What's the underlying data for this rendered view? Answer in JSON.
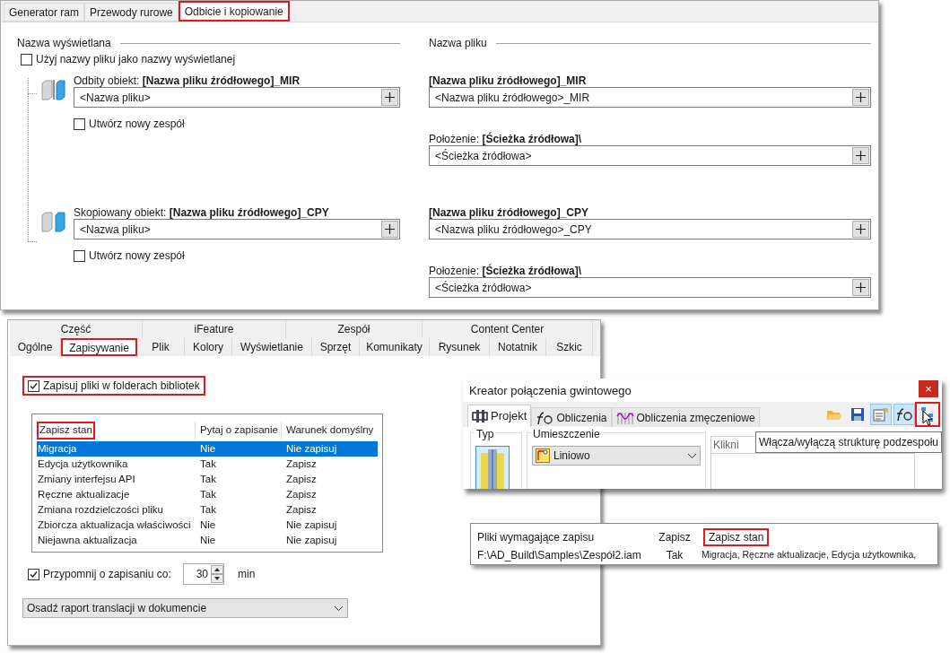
{
  "mirror_dialog": {
    "tabs": [
      {
        "label": "Generator ram",
        "selected": false,
        "highlighted": false
      },
      {
        "label": "Przewody rurowe",
        "selected": false,
        "highlighted": false
      },
      {
        "label": "Odbicie i kopiowanie",
        "selected": true,
        "highlighted": true
      }
    ],
    "display_name": {
      "heading": "Nazwa wyświetlana",
      "use_file_name": {
        "label": "Użyj nazwy pliku jako nazwy wyświetlanej",
        "checked": false
      }
    },
    "file_name": {
      "heading": "Nazwa pliku"
    },
    "items": [
      {
        "kind": "mirror",
        "label": "Odbity obiekt:",
        "value": "[Nazwa pliku źródłowego]_MIR",
        "name_placeholder": "<Nazwa pliku>",
        "new_assembly": {
          "label": "Utwórz nowy zespół",
          "checked": false
        },
        "file_heading": "[Nazwa pliku źródłowego]_MIR",
        "file_value": "<Nazwa pliku źródłowego>_MIR",
        "location_label": "Położenie:",
        "location_bold": "[Ścieżka źródłowa]\\",
        "location_value": "<Ścieżka źródłowa>"
      },
      {
        "kind": "copy",
        "label": "Skopiowany obiekt:",
        "value": "[Nazwa pliku źródłowego]_CPY",
        "name_placeholder": "<Nazwa pliku>",
        "new_assembly": {
          "label": "Utwórz nowy zespół",
          "checked": false
        },
        "file_heading": "[Nazwa pliku źródłowego]_CPY",
        "file_value": "<Nazwa pliku źródłowego>_CPY",
        "location_label": "Położenie:",
        "location_bold": "[Ścieżka źródłowa]\\",
        "location_value": "<Ścieżka źródłowa>"
      }
    ]
  },
  "options_dialog": {
    "tab_rows": [
      [
        {
          "label": "Część",
          "selected": false,
          "highlighted": false
        },
        {
          "label": "iFeature",
          "selected": false,
          "highlighted": false
        },
        {
          "label": "Zespół",
          "selected": false,
          "highlighted": false
        },
        {
          "label": "Content Center",
          "selected": false,
          "highlighted": false
        }
      ],
      [
        {
          "label": "Ogólne",
          "selected": false,
          "highlighted": false
        },
        {
          "label": "Zapisywanie",
          "selected": true,
          "highlighted": true
        },
        {
          "label": "Plik",
          "selected": false,
          "highlighted": false
        },
        {
          "label": "Kolory",
          "selected": false,
          "highlighted": false
        },
        {
          "label": "Wyświetlanie",
          "selected": false,
          "highlighted": false
        },
        {
          "label": "Sprzęt",
          "selected": false,
          "highlighted": false
        },
        {
          "label": "Komunikaty",
          "selected": false,
          "highlighted": false
        },
        {
          "label": "Rysunek",
          "selected": false,
          "highlighted": false
        },
        {
          "label": "Notatnik",
          "selected": false,
          "highlighted": false
        },
        {
          "label": "Szkic",
          "selected": false,
          "highlighted": false
        }
      ]
    ],
    "save_in_library": {
      "label": "Zapisuj pliki w folderach bibliotek",
      "checked": true,
      "highlighted": true
    },
    "table": {
      "columns": [
        {
          "label": "Zapisz stan",
          "highlighted": true
        },
        {
          "label": "Pytaj o zapisanie",
          "highlighted": false
        },
        {
          "label": "Warunek domyślny",
          "highlighted": false
        }
      ],
      "rows": [
        {
          "cells": [
            "Migracja",
            "Nie",
            "Nie zapisuj"
          ],
          "selected": true
        },
        {
          "cells": [
            "Edycja użytkownika",
            "Tak",
            "Zapisz"
          ],
          "selected": false
        },
        {
          "cells": [
            "Zmiany interfejsu API",
            "Tak",
            "Zapisz"
          ],
          "selected": false
        },
        {
          "cells": [
            "Ręczne aktualizacje",
            "Tak",
            "Zapisz"
          ],
          "selected": false
        },
        {
          "cells": [
            "Zmiana rozdzielczości pliku",
            "Tak",
            "Zapisz"
          ],
          "selected": false
        },
        {
          "cells": [
            "Zbiorcza aktualizacja właściwości",
            "Nie",
            "Nie zapisuj"
          ],
          "selected": false
        },
        {
          "cells": [
            "Niejawna aktualizacja",
            "Nie",
            "Nie zapisuj"
          ],
          "selected": false
        }
      ]
    },
    "remind": {
      "label": "Przypomnij o zapisaniu co:",
      "checked": true,
      "value": "30",
      "unit": "min"
    },
    "dropdown": {
      "value": "Osadź raport translacji w dokumencie"
    }
  },
  "wizard": {
    "title": "Kreator połączenia gwintowego",
    "close": "×",
    "tabs": [
      {
        "label": "Projekt",
        "selected": true
      },
      {
        "label": "Obliczenia",
        "selected": false
      },
      {
        "label": "Obliczenia zmęczeniowe",
        "selected": false
      }
    ],
    "tools": [
      {
        "kind": "folder",
        "pressed": false,
        "highlighted": false
      },
      {
        "kind": "save",
        "pressed": false,
        "highlighted": false
      },
      {
        "kind": "properties",
        "pressed": true,
        "highlighted": false
      },
      {
        "kind": "calc",
        "pressed": true,
        "highlighted": false
      },
      {
        "kind": "tree",
        "pressed": false,
        "highlighted": true
      }
    ],
    "tooltip": "Włącza/wyłączą strukturę podzespołu",
    "type_group": "Typ",
    "placement_group": "Umieszczenie",
    "placement_value": "Liniowo",
    "list_header": "Klikni"
  },
  "save_list": {
    "columns": [
      {
        "label": "Pliki wymagające zapisu",
        "highlighted": false
      },
      {
        "label": "Zapisz",
        "highlighted": false
      },
      {
        "label": "Zapisz stan",
        "highlighted": true
      }
    ],
    "rows": [
      {
        "cells": [
          "F:\\AD_Build\\Samples\\Zespół2.iam",
          "Tak",
          "Migracja, Ręczne aktualizacje, Edycja użytkownika,"
        ]
      }
    ]
  }
}
